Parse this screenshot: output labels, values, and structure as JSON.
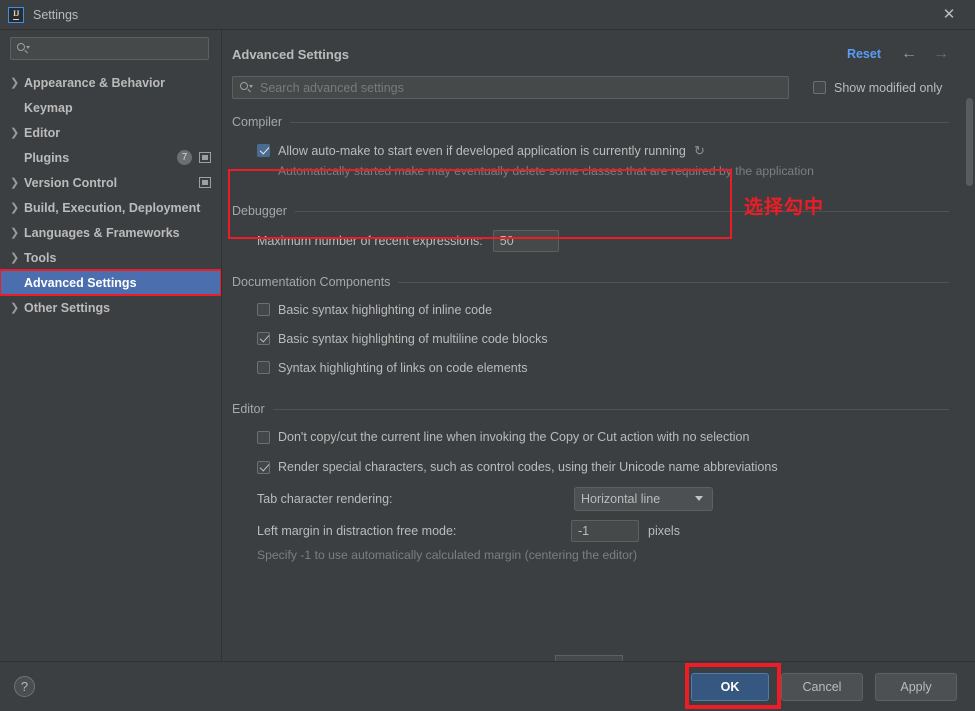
{
  "window": {
    "title": "Settings",
    "logo_text": "IJ",
    "close_icon": "close-icon"
  },
  "sidebar": {
    "search_placeholder": "",
    "items": [
      {
        "label": "Appearance & Behavior",
        "expandable": true,
        "selected": false,
        "badge": null,
        "icon": null
      },
      {
        "label": "Keymap",
        "expandable": false,
        "selected": false,
        "badge": null,
        "icon": null
      },
      {
        "label": "Editor",
        "expandable": true,
        "selected": false,
        "badge": null,
        "icon": null
      },
      {
        "label": "Plugins",
        "expandable": false,
        "selected": false,
        "badge": "7",
        "icon": "panel-icon"
      },
      {
        "label": "Version Control",
        "expandable": true,
        "selected": false,
        "badge": null,
        "icon": "panel-icon"
      },
      {
        "label": "Build, Execution, Deployment",
        "expandable": true,
        "selected": false,
        "badge": null,
        "icon": null
      },
      {
        "label": "Languages & Frameworks",
        "expandable": true,
        "selected": false,
        "badge": null,
        "icon": null
      },
      {
        "label": "Tools",
        "expandable": true,
        "selected": false,
        "badge": null,
        "icon": null
      },
      {
        "label": "Advanced Settings",
        "expandable": false,
        "selected": true,
        "badge": null,
        "icon": null
      },
      {
        "label": "Other Settings",
        "expandable": true,
        "selected": false,
        "badge": null,
        "icon": null
      }
    ]
  },
  "main": {
    "title": "Advanced Settings",
    "reset_label": "Reset",
    "back_icon": "arrow-left-icon",
    "forward_icon": "arrow-right-icon",
    "search_placeholder": "Search advanced settings",
    "show_modified_label": "Show modified only",
    "show_modified_checked": false,
    "sections": [
      {
        "title": "Compiler",
        "options": [
          {
            "type": "checkbox",
            "label": "Allow auto-make to start even if developed application is currently running",
            "checked": true,
            "focused": true,
            "revert_icon": "revert-icon",
            "description": "Automatically started make may eventually delete some classes that are required by the application"
          }
        ]
      },
      {
        "title": "Debugger",
        "options": [
          {
            "type": "text-field",
            "label": "Maximum number of recent expressions:",
            "value": "50"
          }
        ]
      },
      {
        "title": "Documentation Components",
        "options": [
          {
            "type": "checkbox",
            "label": "Basic syntax highlighting of inline code",
            "checked": false
          },
          {
            "type": "checkbox",
            "label": "Basic syntax highlighting of multiline code blocks",
            "checked": true
          },
          {
            "type": "checkbox",
            "label": "Syntax highlighting of links on code elements",
            "checked": false
          }
        ]
      },
      {
        "title": "Editor",
        "options": [
          {
            "type": "checkbox",
            "label": "Don't copy/cut the current line when invoking the Copy or Cut action with no selection",
            "checked": false
          },
          {
            "type": "checkbox",
            "label": "Render special characters, such as control codes, using their Unicode name abbreviations",
            "checked": true
          },
          {
            "type": "combo",
            "label": "Tab character rendering:",
            "value": "Horizontal line"
          },
          {
            "type": "text-field-unit",
            "label": "Left margin in distraction free mode:",
            "value": "-1",
            "unit": "pixels",
            "description": "Specify -1 to use automatically calculated margin (centering the editor)"
          }
        ]
      }
    ]
  },
  "annotations": {
    "compiler_note": "选择勾中",
    "highlight_color": "#ee1c25"
  },
  "footer": {
    "help_label": "?",
    "ok_label": "OK",
    "cancel_label": "Cancel",
    "apply_label": "Apply"
  }
}
